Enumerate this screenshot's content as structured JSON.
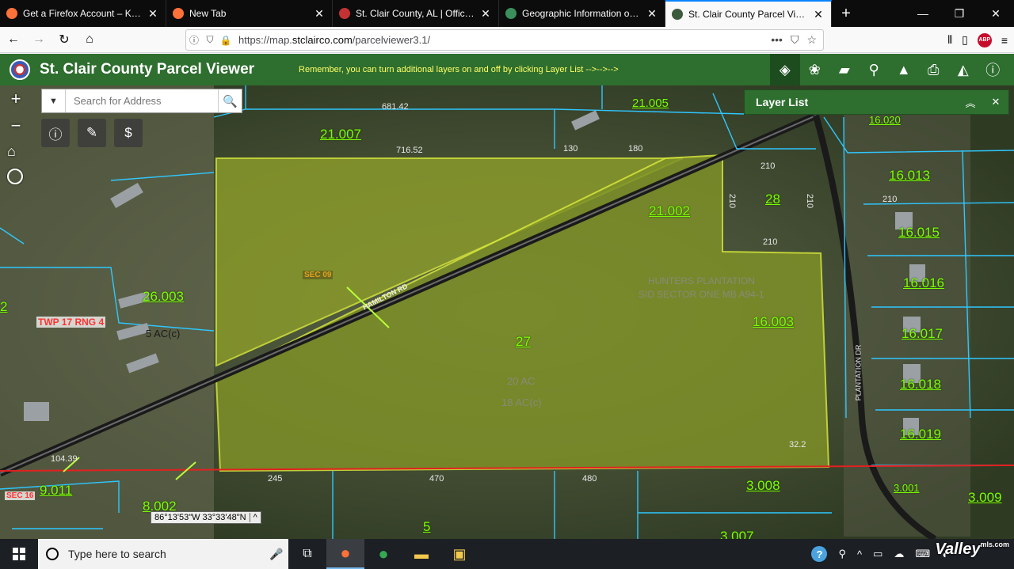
{
  "browser": {
    "tabs": [
      {
        "label": "Get a Firefox Account – Keep y",
        "favicon_color": "#ff7139"
      },
      {
        "label": "New Tab",
        "favicon_color": "#ff7139"
      },
      {
        "label": "St. Clair County, AL | Official W",
        "favicon_color": "#c33333"
      },
      {
        "label": "Geographic Information of ... St",
        "favicon_color": "#3a8f5a"
      },
      {
        "label": "St. Clair County Parcel Viewer",
        "favicon_color": "#3c5a3c"
      }
    ],
    "active_tab_index": 4,
    "url_prefix": "https://map.",
    "url_domain": "stclairco.com",
    "url_path": "/parcelviewer3.1/",
    "more_glyph": "•••",
    "adblock_label": "ABP"
  },
  "app": {
    "title": "St. Clair County Parcel Viewer",
    "reminder": "Remember, you can turn additional layers on and off by clicking Layer List -->-->-->",
    "toolbar": [
      {
        "icon": "layers-icon",
        "glyph": "◈"
      },
      {
        "icon": "basemap-icon",
        "glyph": "❀"
      },
      {
        "icon": "measure-icon",
        "glyph": "▰"
      },
      {
        "icon": "person-icon",
        "glyph": "⚲"
      },
      {
        "icon": "education-icon",
        "glyph": "▲"
      },
      {
        "icon": "print-icon",
        "glyph": "⎙"
      },
      {
        "icon": "map-icon",
        "glyph": "◭"
      },
      {
        "icon": "info-icon",
        "glyph": "ⓘ"
      }
    ]
  },
  "map": {
    "search_placeholder": "Search for Address",
    "search_button_glyph": "🔍",
    "dropdown_glyph": "▼",
    "zoom_in": "+",
    "zoom_out": "−",
    "home_glyph": "⌂",
    "widgets": [
      {
        "icon": "identify-icon",
        "glyph": "ⓘ"
      },
      {
        "icon": "draw-icon",
        "glyph": "✎"
      },
      {
        "icon": "sales-icon",
        "glyph": "$"
      }
    ],
    "layer_list": {
      "title": "Layer List",
      "collapse_glyph": "︽",
      "close_glyph": "✕"
    },
    "coordinates": "86°13'53\"W 33°33'48\"N",
    "coord_toggle": "^",
    "labels": {
      "p21007": "21.007",
      "p21005": "21.005",
      "p21002": "21.002",
      "p28": "28",
      "p16020": "16.020",
      "p16013": "16.013",
      "p16015": "16.015",
      "p16016": "16.016",
      "p16017": "16.017",
      "p16018": "16.018",
      "p16019": "16.019",
      "p16003": "16.003",
      "p27": "27",
      "p26003": "26.003",
      "p3008": "3.008",
      "p3001": "3.001",
      "p3009": "3.009",
      "p3007": "3.007",
      "p8002": "8.002",
      "p9011": "9.011",
      "p5": "5",
      "p2": "2"
    },
    "dims": {
      "d68142": "681.42",
      "d71652": "716.52",
      "d130": "130",
      "d180": "180",
      "d210a": "210",
      "d210b": "210",
      "d210c": "210",
      "d210d": "210",
      "d245": "245",
      "d470": "470",
      "d480": "480",
      "d322": "32.2",
      "d10439": "104.39",
      "d210e": "210"
    },
    "texts": {
      "sec09": "SEC 09",
      "road": "HAMILTON RD",
      "subdivision1": "HUNTERS PLANTATION",
      "subdivision2": "SID SECTOR ONE MB A94-1",
      "twp": "TWP 17  RNG 4",
      "acres5": "5 AC(c)",
      "acres20": "20 AC",
      "acres18": "18 AC(c)",
      "sec16": "SEC 16",
      "plantation": "PLANTATION DR"
    }
  },
  "taskbar": {
    "search_placeholder": "Type here to search",
    "mic_glyph": "🎤",
    "apps": [
      {
        "icon": "task-view-icon",
        "glyph": "⧉",
        "color": "#ffffff"
      },
      {
        "icon": "firefox-icon",
        "glyph": "●",
        "color": "#ff7139"
      },
      {
        "icon": "chrome-icon",
        "glyph": "●",
        "color": "#34a853"
      },
      {
        "icon": "file-explorer-icon",
        "glyph": "▬",
        "color": "#f2c94c"
      },
      {
        "icon": "store-icon",
        "glyph": "▣",
        "color": "#f2c94c"
      }
    ],
    "help_glyph": "?",
    "tray_glyphs": [
      "⚲",
      "^",
      "▭",
      "☁",
      "⌨",
      "◖"
    ]
  },
  "watermark": {
    "brand": "Valley",
    "suffix": "mls.com"
  }
}
